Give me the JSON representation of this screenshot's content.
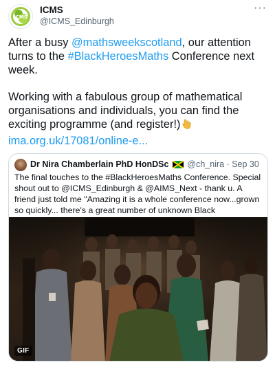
{
  "author": {
    "name": "ICMS",
    "handle": "@ICMS_Edinburgh",
    "avatar_icon": "icms-logo-icon"
  },
  "more_icon": "more-options-icon",
  "more_glyph": "···",
  "body": {
    "p1_pre": "After a busy ",
    "p1_mention": "@mathsweekscotland",
    "p1_mid": ", our attention turns to the ",
    "p1_hashtag": "#BlackHeroesMaths",
    "p1_post": " Conference next week.",
    "p2_text": "Working  with a fabulous group of mathematical organisations and individuals, you can find the exciting programme (and register!)",
    "p2_emoji": "pointing-down-hand-emoji",
    "link": "ima.org.uk/17081/online-e..."
  },
  "quote": {
    "name": "Dr Nira Chamberlain PhD HonDSc",
    "flag_icon": "jamaica-flag-icon",
    "handle": "@ch_nira",
    "separator": " · ",
    "date": "Sep 30",
    "text": "The final touches to the #BlackHeroesMaths Conference. Special shout out to @ICMS_Edinburgh & @AIMS_Next - thank u. A friend just told me \"Amazing it is a whole conference now...grown so quickly... there's a great number of unknown Black mathematicians out there!\" @IMAmaths",
    "media_badge": "GIF"
  },
  "colors": {
    "link": "#1d9bf0",
    "text": "#0f1419",
    "secondary": "#536471",
    "border": "#cfd9de"
  }
}
